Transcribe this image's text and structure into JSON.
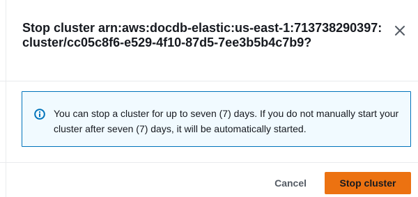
{
  "modal": {
    "title": "Stop cluster arn:aws:docdb-elastic:us-east-1:713738290397:cluster/cc05c8f6-e529-4f10-87d5-7ee3b5b4c7b9?",
    "close_icon": "close-icon"
  },
  "alert": {
    "icon": "info-icon",
    "message": "You can stop a cluster for up to seven (7) days. If you do not manually start your cluster after seven (7) days, it will be automatically started."
  },
  "footer": {
    "cancel_label": "Cancel",
    "primary_label": "Stop cluster"
  },
  "colors": {
    "primary": "#ec7211",
    "info_border": "#0073bb",
    "info_bg": "#f1faff",
    "text": "#16191f",
    "secondary_text": "#545b64"
  }
}
